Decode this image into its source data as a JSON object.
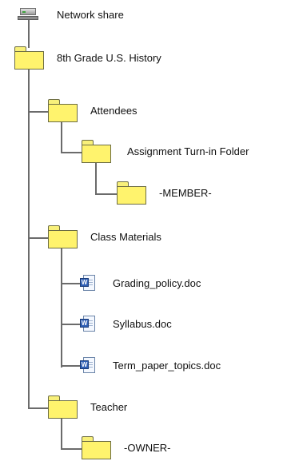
{
  "tree": {
    "root": {
      "label": "Network share",
      "icon": "network-share-icon"
    },
    "course": {
      "label": "8th Grade U.S. History",
      "icon": "folder-icon",
      "attendees": {
        "label": "Attendees",
        "icon": "folder-icon",
        "turnin": {
          "label": "Assignment Turn-in Folder",
          "icon": "folder-icon",
          "member": {
            "label": "-MEMBER-",
            "icon": "folder-icon"
          }
        }
      },
      "class_materials": {
        "label": "Class Materials",
        "icon": "folder-icon",
        "docs": [
          {
            "label": "Grading_policy.doc",
            "icon": "word-document-icon",
            "badge": "W"
          },
          {
            "label": "Syllabus.doc",
            "icon": "word-document-icon",
            "badge": "W"
          },
          {
            "label": "Term_paper_topics.doc",
            "icon": "word-document-icon",
            "badge": "W"
          }
        ]
      },
      "teacher": {
        "label": "Teacher",
        "icon": "folder-icon",
        "owner": {
          "label": "-OWNER-",
          "icon": "folder-icon"
        }
      }
    }
  },
  "colors": {
    "folder_fill": "#fff36d",
    "folder_border": "#6d6d44",
    "connector": "#6b6b6b",
    "text": "#111111"
  }
}
